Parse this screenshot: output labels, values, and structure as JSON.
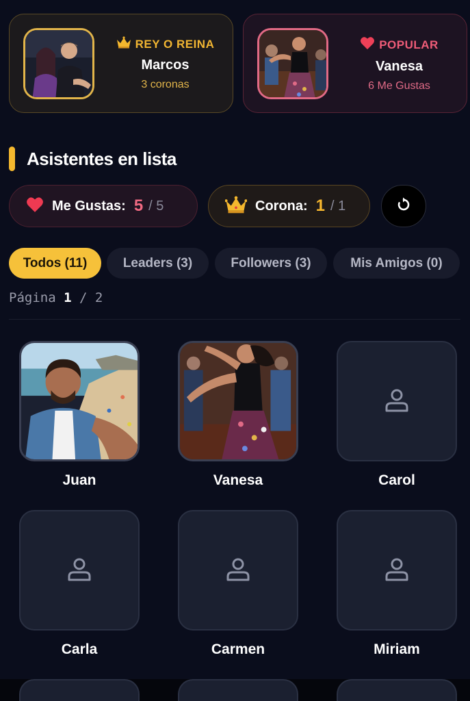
{
  "highlights": {
    "king": {
      "tag": "REY O REINA",
      "name": "Marcos",
      "sub": "3 coronas"
    },
    "popular": {
      "tag": "POPULAR",
      "name": "Vanesa",
      "sub": "6 Me Gustas"
    }
  },
  "section": {
    "title": "Asistentes en lista"
  },
  "counters": {
    "likes": {
      "label": "Me Gustas:",
      "value": "5",
      "max": "/ 5"
    },
    "crown": {
      "label": "Corona:",
      "value": "1",
      "max": "/ 1"
    }
  },
  "tabs": [
    {
      "label": "Todos (11)",
      "active": true
    },
    {
      "label": "Leaders (3)"
    },
    {
      "label": "Followers (3)"
    },
    {
      "label": "Mis Amigos (0)"
    }
  ],
  "pager": {
    "prefix": "Página",
    "current": "1",
    "sep": "/",
    "total": "2"
  },
  "attendees": [
    {
      "name": "Juan"
    },
    {
      "name": "Vanesa"
    },
    {
      "name": "Carol"
    },
    {
      "name": "Carla"
    },
    {
      "name": "Carmen"
    },
    {
      "name": "Miriam"
    }
  ],
  "icons": {
    "crown": "crown-icon",
    "heart": "heart-icon",
    "refresh": "refresh-icon",
    "user": "user-placeholder-icon"
  },
  "colors": {
    "accent": "#f6c13a",
    "like": "#ef5c78",
    "background": "#0a0d1c"
  }
}
